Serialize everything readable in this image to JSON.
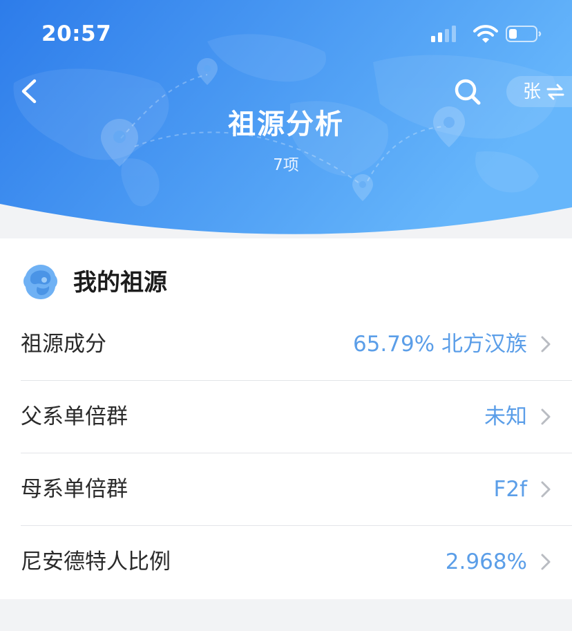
{
  "status_bar": {
    "time": "20:57",
    "icons": [
      "cellular-signal-icon",
      "wifi-icon",
      "battery-icon"
    ]
  },
  "header": {
    "title": "祖源分析",
    "subtitle": "7项",
    "surname": "张",
    "gradient_colors": [
      "#2f7fec",
      "#62b2fb"
    ]
  },
  "section": {
    "title": "我的祖源",
    "icon": "ancestry-head-icon"
  },
  "rows": [
    {
      "label": "祖源成分",
      "value": "65.79% 北方汉族"
    },
    {
      "label": "父系单倍群",
      "value": "未知"
    },
    {
      "label": "母系单倍群",
      "value": "F2f"
    },
    {
      "label": "尼安德特人比例",
      "value": "2.968%"
    }
  ],
  "colors": {
    "accent_value": "#5b9ee8",
    "chevron": "#b9bcc2",
    "divider": "#e2e4e8",
    "page_background": "#f2f3f5"
  }
}
